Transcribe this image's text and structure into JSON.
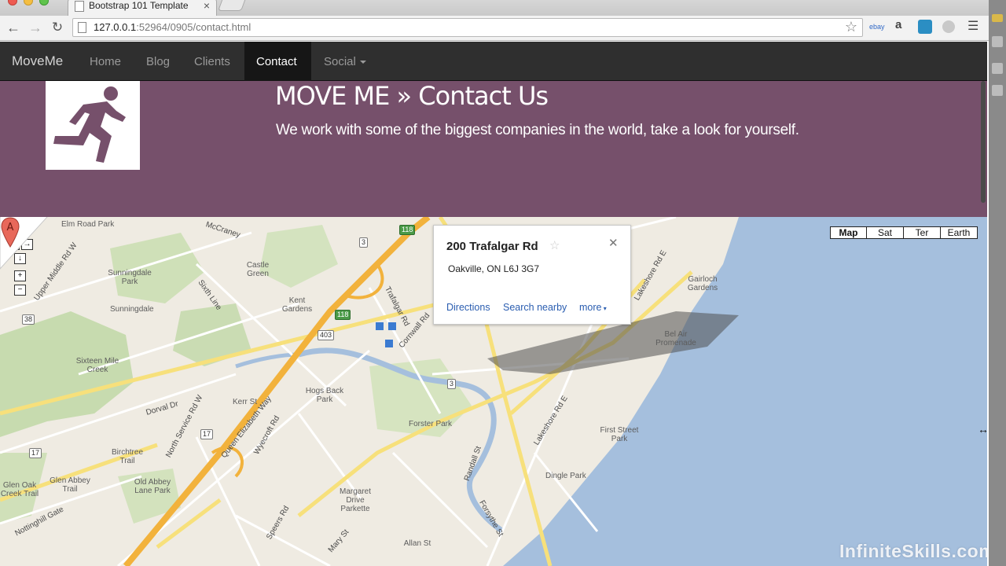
{
  "browser": {
    "tab_title": "Bootstrap 101 Template",
    "url_host": "127.0.0.1",
    "url_rest": ":52964/0905/contact.html"
  },
  "navbar": {
    "brand": "MoveMe",
    "links": [
      "Home",
      "Blog",
      "Clients",
      "Contact",
      "Social"
    ],
    "active": "Contact"
  },
  "hero": {
    "title": "MOVE ME » Contact Us",
    "subtitle": "We work with some of the biggest companies in the world, take a look for yourself."
  },
  "map": {
    "types": [
      "Map",
      "Sat",
      "Ter",
      "Earth"
    ],
    "selected_type": "Map",
    "infowindow": {
      "title": "200 Trafalgar Rd",
      "address": "Oakville, ON L6J 3G7",
      "links": [
        "Directions",
        "Search nearby",
        "more"
      ]
    },
    "marker_label": "A",
    "places": [
      "Elm Road Park",
      "McCraney",
      "Castle Green",
      "Sunningdale Park",
      "Sixth Line",
      "Kent Gardens",
      "Sunningdale",
      "Upper Middle Rd W",
      "Trafalgar Rd",
      "Cornwall Rd",
      "Sixteen Mile Creek",
      "Hogs Back Park",
      "Queen Elizabeth Way",
      "Kerr St",
      "Dorval Dr",
      "North Service Rd W",
      "Wyecroft Rd",
      "Forster Park",
      "Lakeshore Rd E",
      "First Street Park",
      "Dingle Park",
      "Birchtree Trail",
      "Old Abbey Lane Park",
      "Glen Abbey Trail",
      "Glen Oak Creek Trail",
      "Nottinghill Gate",
      "Margaret Drive Parkette",
      "Randall St",
      "Forsythe St",
      "Speers Rd",
      "Mary St",
      "Gairloch Gardens",
      "Bel Air Promenade",
      "Lakeshore Rd E",
      "Allan St"
    ],
    "shields": [
      "3",
      "118",
      "118",
      "403",
      "3",
      "17",
      "17",
      "38"
    ]
  },
  "watermark": "InfiniteSkills.com"
}
